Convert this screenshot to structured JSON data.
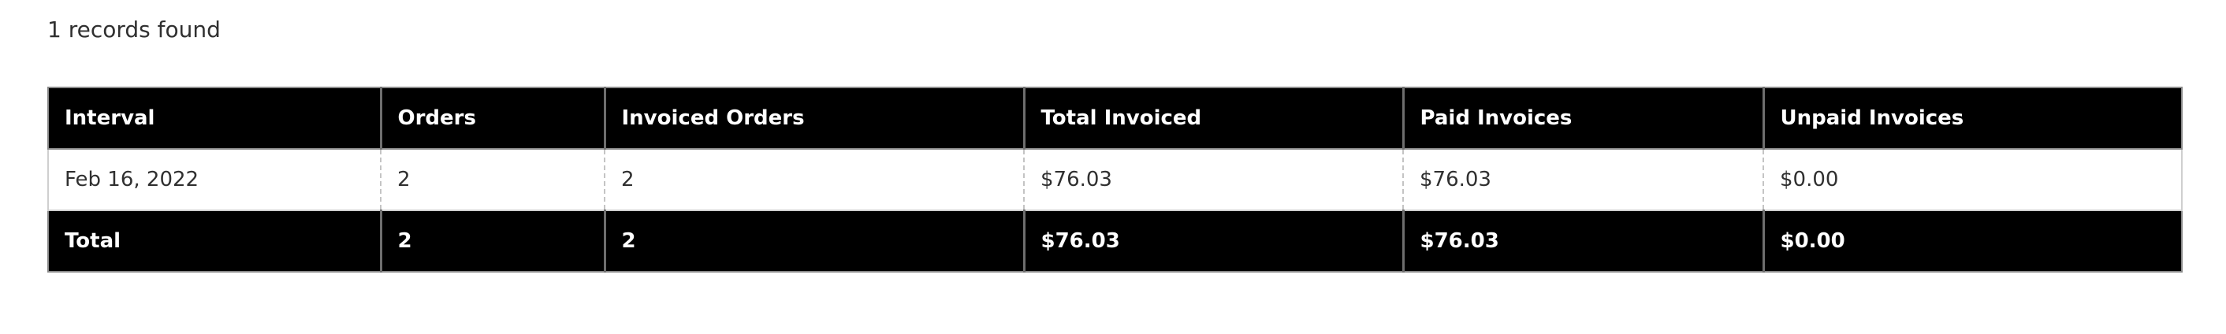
{
  "summary": {
    "records_found": "1 records found"
  },
  "table": {
    "headers": [
      "Interval",
      "Orders",
      "Invoiced Orders",
      "Total Invoiced",
      "Paid Invoices",
      "Unpaid Invoices"
    ],
    "rows": [
      [
        "Feb 16, 2022",
        "2",
        "2",
        "$76.03",
        "$76.03",
        "$0.00"
      ]
    ],
    "totals": [
      "Total",
      "2",
      "2",
      "$76.03",
      "$76.03",
      "$0.00"
    ]
  },
  "colors": {
    "header_background": "#000000",
    "header_text": "#ffffff",
    "body_text": "#303030"
  }
}
